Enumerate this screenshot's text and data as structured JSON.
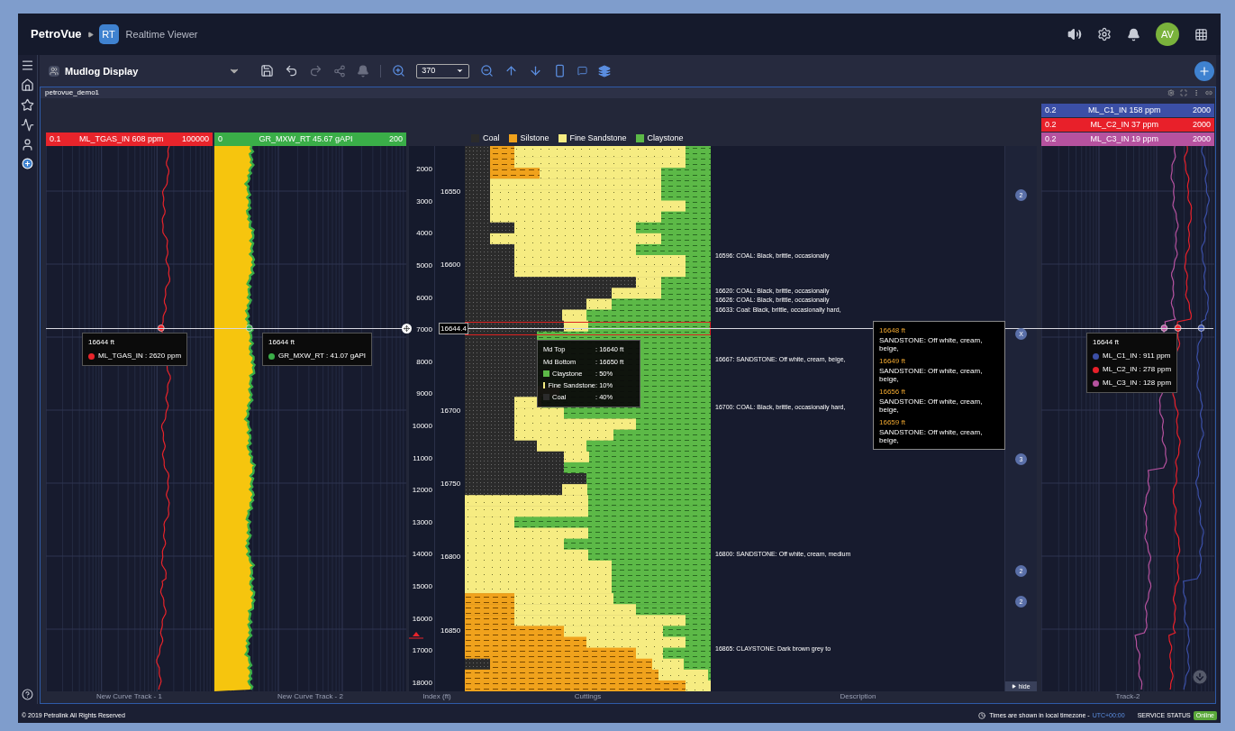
{
  "app": {
    "brand": "PetroVue",
    "badge": "RT",
    "title": "Realtime Viewer",
    "avatar": "AV"
  },
  "toolbar": {
    "display": "Mudlog Display",
    "zoom": "370"
  },
  "panel": {
    "title": "petrovue_demo1"
  },
  "left_tracks": [
    {
      "min": "0.1",
      "label": "ML_TGAS_IN 608 ppm",
      "max": "100000",
      "color": "#e8242b"
    },
    {
      "min": "0",
      "label": "GR_MXW_RT 45.67 gAPI",
      "max": "200",
      "color": "#3aae48"
    }
  ],
  "legend": [
    {
      "label": "Coal",
      "color": "#2b2b2b"
    },
    {
      "label": "Silstone",
      "color": "#f0a21c"
    },
    {
      "label": "Fine Sandstone",
      "color": "#f6ec82"
    },
    {
      "label": "Claystone",
      "color": "#5cb947"
    }
  ],
  "right_tracks": [
    {
      "min": "0.2",
      "label": "ML_C1_IN 158 ppm",
      "max": "2000",
      "color": "#3b4fa6"
    },
    {
      "min": "0.2",
      "label": "ML_C2_IN 37 ppm",
      "max": "2000",
      "color": "#e8202a"
    },
    {
      "min": "0.2",
      "label": "ML_C3_IN 19 ppm",
      "max": "2000",
      "color": "#b6529f"
    }
  ],
  "index": {
    "counts": [
      "2000",
      "3000",
      "4000",
      "5000",
      "6000",
      "7000",
      "8000",
      "9000",
      "10000",
      "11000",
      "12000",
      "13000",
      "14000",
      "15000",
      "16000",
      "17000",
      "18000"
    ],
    "depths": [
      "16550",
      "16600",
      "16700",
      "16750",
      "16800",
      "16850"
    ],
    "cursor": "16644.4"
  },
  "descriptions": [
    "16596: COAL: Black, brittle, occasionally",
    "16620: COAL: Black, brittle, occasionally",
    "16626: COAL: Black, brittle, occasionally",
    "16633: Coal: Black, brittle, occasionally hard,",
    "16667: SANDSTONE: Off white, cream, beige,",
    "16700: COAL: Black, brittle, occasionally hard,",
    "16800: SANDSTONE: Off white, cream, medium",
    "16865: CLAYSTONE: Dark brown grey to"
  ],
  "markers": [
    "2",
    "X",
    "3",
    "2",
    "2"
  ],
  "hide_button": "hide",
  "curve_tooltips": [
    {
      "depth": "16644 ft",
      "items": [
        {
          "label": "ML_TGAS_IN : 2620 ppm",
          "color": "#e8242b"
        }
      ]
    },
    {
      "depth": "16644 ft",
      "items": [
        {
          "label": "GR_MXW_RT : 41.07 gAPI",
          "color": "#3aae48"
        }
      ]
    },
    {
      "depth": "16644 ft",
      "items": [
        {
          "label": "ML_C1_IN : 911 ppm",
          "color": "#3b4fa6"
        },
        {
          "label": "ML_C2_IN : 278 ppm",
          "color": "#e8202a"
        },
        {
          "label": "ML_C3_IN : 128 ppm",
          "color": "#b6529f"
        }
      ]
    }
  ],
  "cuttings_tooltip": [
    {
      "label": "Md Top",
      "value": ": 16640 ft"
    },
    {
      "label": "Md Bottom",
      "value": ": 16650 ft"
    },
    {
      "label": "Claystone",
      "value": ": 50%",
      "color": "#5cb947"
    },
    {
      "label": "Fine Sandstone",
      "value": ": 10%",
      "color": "#f6ec82"
    },
    {
      "label": "Coal",
      "value": ": 40%",
      "color": "#2b2b2b"
    }
  ],
  "description_tooltip": [
    {
      "depth": "16648 ft",
      "text": "SANDSTONE: Off white, cream, beige,"
    },
    {
      "depth": "16649 ft",
      "text": "SANDSTONE: Off white, cream, beige,"
    },
    {
      "depth": "16656 ft",
      "text": "SANDSTONE: Off white, cream, beige,"
    },
    {
      "depth": "16659 ft",
      "text": "SANDSTONE: Off white, cream, beige,"
    }
  ],
  "footers": [
    "New Curve Track - 1",
    "New Curve Track - 2",
    "Index (ft)",
    "Cuttings",
    "Description",
    "Track-2"
  ],
  "status": {
    "copyright": "© 2019 Petrolink All Rights Reserved",
    "timezone": "Times are shown in local timezone -",
    "utc": "UTC+00:00",
    "service": "SERVICE STATUS",
    "online": "Online"
  }
}
